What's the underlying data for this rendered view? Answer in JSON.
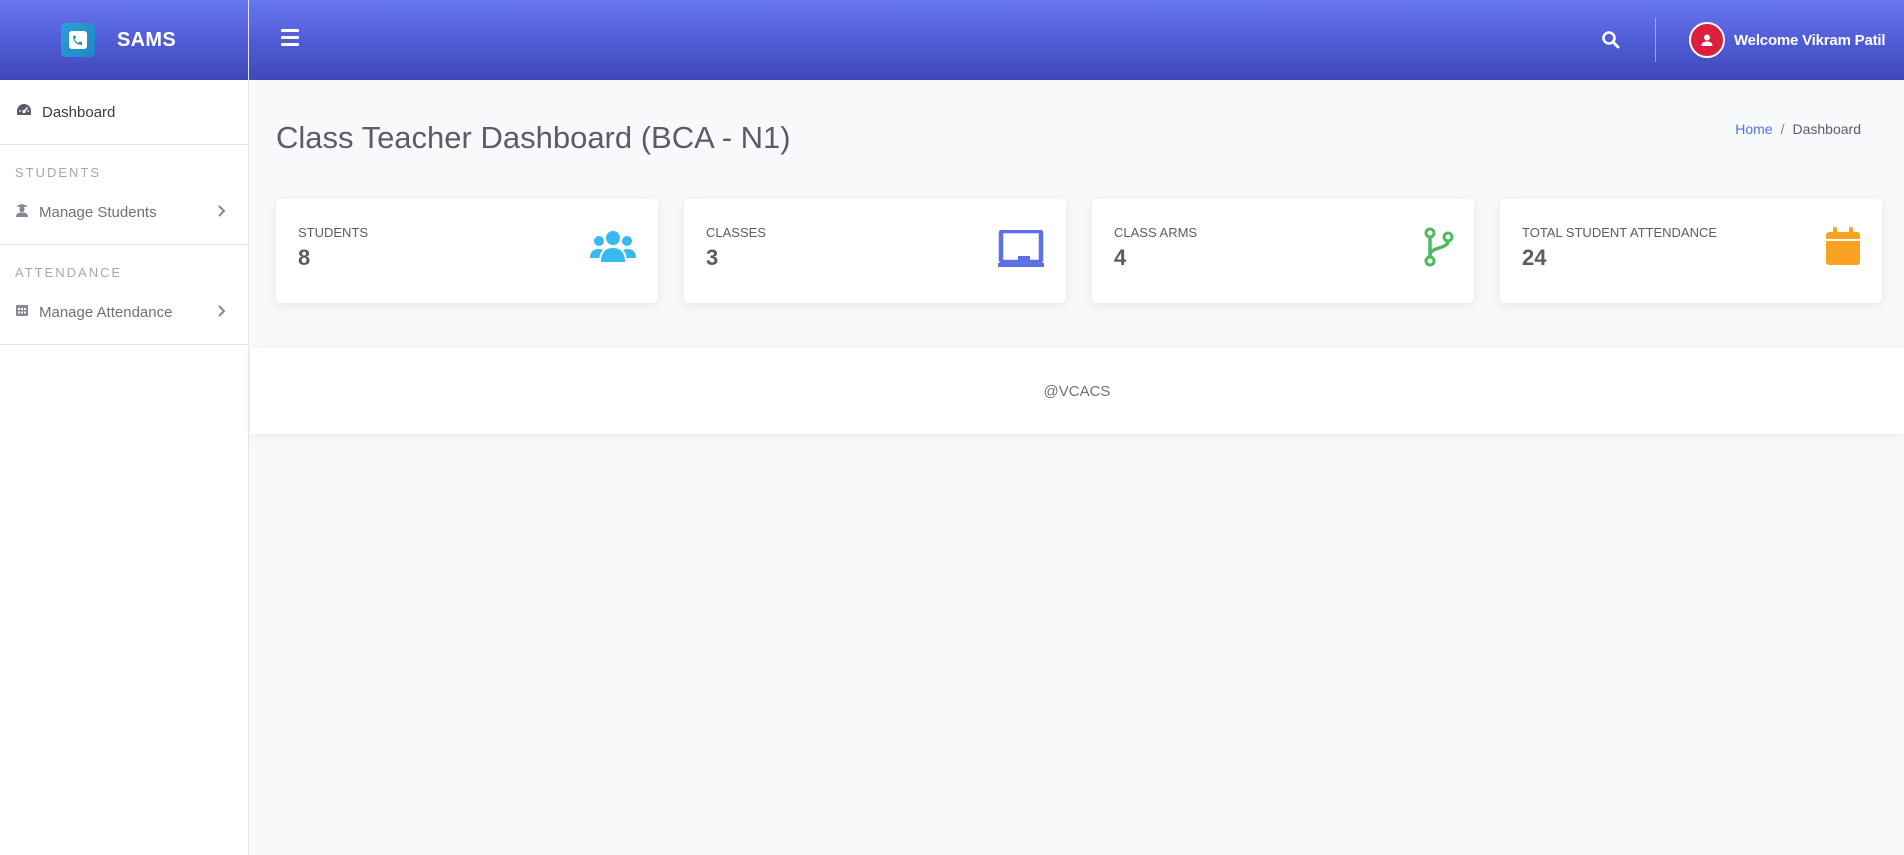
{
  "brand": {
    "name": "SAMS"
  },
  "topbar": {
    "welcome": "Welcome Vikram Patil"
  },
  "sidebar": {
    "dashboard_label": "Dashboard",
    "sections": [
      {
        "heading": "STUDENTS",
        "link_label": "Manage Students"
      },
      {
        "heading": "ATTENDANCE",
        "link_label": "Manage Attendance"
      }
    ]
  },
  "page": {
    "title": "Class Teacher Dashboard (BCA - N1)",
    "breadcrumb": {
      "home": "Home",
      "separator": "/",
      "current": "Dashboard"
    }
  },
  "cards": [
    {
      "title": "Students",
      "value": "8",
      "icon": "users-icon",
      "color": "#36b9f0"
    },
    {
      "title": "Classes",
      "value": "3",
      "icon": "chalkboard-icon",
      "color": "#5f6fe5"
    },
    {
      "title": "Class Arms",
      "value": "4",
      "icon": "code-branch-icon",
      "color": "#4cbb5c"
    },
    {
      "title": "Total Student Attendance",
      "value": "24",
      "icon": "calendar-icon",
      "color": "#fca223"
    }
  ],
  "footer": {
    "text": "@VCACS"
  },
  "colors": {
    "topbar_start": "#6777ef",
    "topbar_end": "#3f48b8",
    "avatar": "#dc1f3c",
    "link": "#4e73df"
  }
}
